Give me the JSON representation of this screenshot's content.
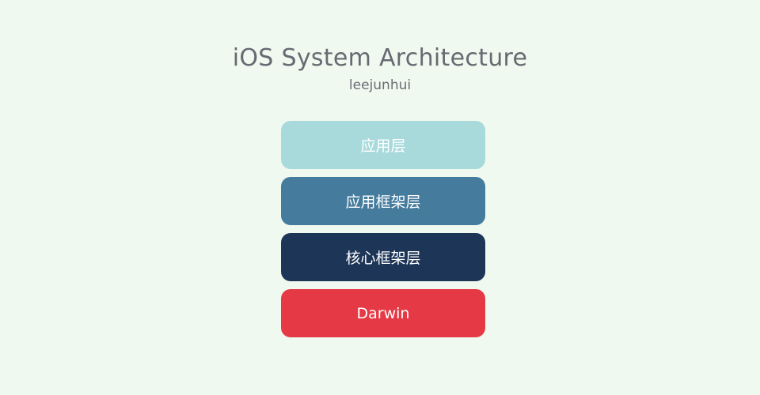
{
  "title": "iOS System Architecture",
  "subtitle": "leejunhui",
  "layers": [
    {
      "label": "应用层",
      "color": "#a8dadc"
    },
    {
      "label": "应用框架层",
      "color": "#457b9d"
    },
    {
      "label": "核心框架层",
      "color": "#1d3557"
    },
    {
      "label": "Darwin",
      "color": "#e63946"
    }
  ],
  "colors": {
    "background": "#f0f9ef",
    "title_text": "#666a72",
    "layer_text": "#ffffff"
  }
}
